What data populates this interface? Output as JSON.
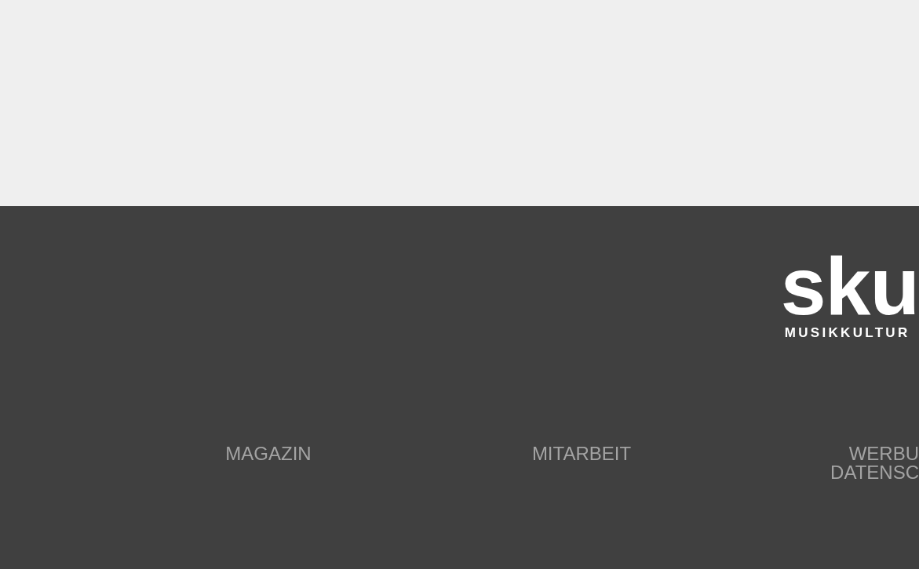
{
  "footer": {
    "logo": {
      "wordmark": "sku",
      "tagline": "MUSIKKULTUR"
    },
    "links": [
      [
        "MAGAZIN"
      ],
      [
        "MITARBEIT"
      ],
      [
        "WERBU",
        "DATENSC"
      ]
    ]
  }
}
